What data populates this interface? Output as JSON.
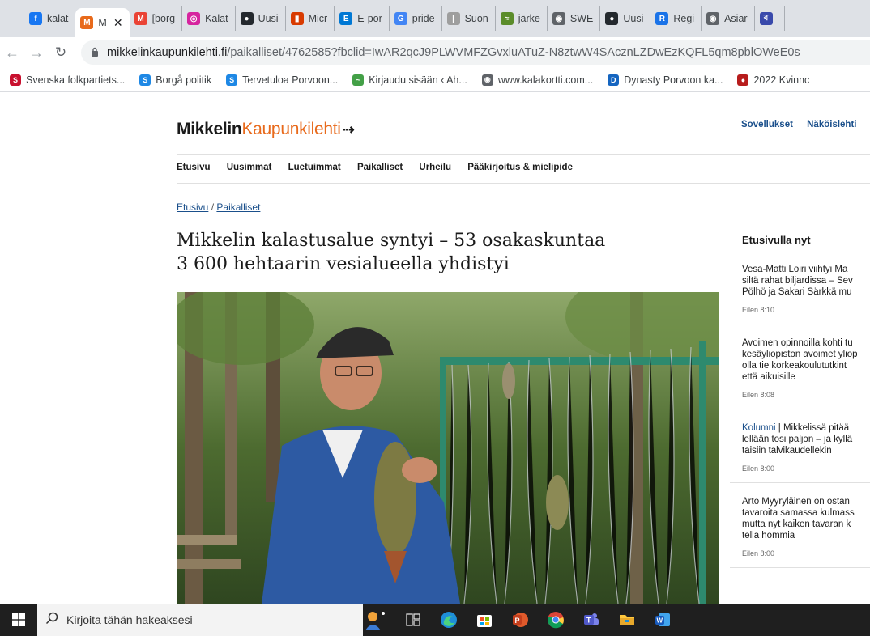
{
  "tabs": [
    {
      "label": "kalat",
      "icon": "facebook-icon",
      "color": "#1877f2",
      "glyph": "f"
    },
    {
      "label": "M",
      "icon": "site-icon",
      "color": "#e86a1c",
      "glyph": "M",
      "active": true
    },
    {
      "label": "[borg",
      "icon": "gmail-icon",
      "color": "#ea4335",
      "glyph": "M"
    },
    {
      "label": "Kalat",
      "icon": "instagram-icon",
      "color": "#d6249f",
      "glyph": "◎"
    },
    {
      "label": "Uusi",
      "icon": "github-icon",
      "color": "#24292e",
      "glyph": "●"
    },
    {
      "label": "Micr",
      "icon": "office-icon",
      "color": "#d83b01",
      "glyph": "▮"
    },
    {
      "label": "E-por",
      "icon": "portal-icon",
      "color": "#0078d4",
      "glyph": "E"
    },
    {
      "label": "pride",
      "icon": "google-icon",
      "color": "#4285f4",
      "glyph": "G"
    },
    {
      "label": "Suon",
      "icon": "generic-icon",
      "color": "#9e9e9e",
      "glyph": "|"
    },
    {
      "label": "järke",
      "icon": "fishing-icon",
      "color": "#5b8c2a",
      "glyph": "≈"
    },
    {
      "label": "SWE",
      "icon": "globe-icon",
      "color": "#5f6368",
      "glyph": "◉"
    },
    {
      "label": "Uusi",
      "icon": "github-icon",
      "color": "#24292e",
      "glyph": "●"
    },
    {
      "label": "Regi",
      "icon": "registry-icon",
      "color": "#1a73e8",
      "glyph": "R"
    },
    {
      "label": "Asiar",
      "icon": "globe-icon",
      "color": "#5f6368",
      "glyph": "◉"
    },
    {
      "label": "",
      "icon": "misc-icon",
      "color": "#3949ab",
      "glyph": "ব"
    }
  ],
  "url": {
    "domain": "mikkelinkaupunkilehti.fi",
    "path": "/paikalliset/4762585?fbclid=IwAR2qcJ9PLWVMFZGvxluATuZ-N8ztwW4SAcznLZDwEzKQFL5qm8pblOWeE0s"
  },
  "bookmarks": [
    {
      "label": "Svenska folkpartiets...",
      "color": "#c8102e",
      "glyph": "S"
    },
    {
      "label": "Borgå politik",
      "color": "#1e88e5",
      "glyph": "S"
    },
    {
      "label": "Tervetuloa Porvoon...",
      "color": "#1e88e5",
      "glyph": "S"
    },
    {
      "label": "Kirjaudu sisään ‹ Ah...",
      "color": "#43a047",
      "glyph": "~"
    },
    {
      "label": "www.kalakortti.com...",
      "color": "#5f6368",
      "glyph": "◉"
    },
    {
      "label": "Dynasty Porvoon ka...",
      "color": "#1565c0",
      "glyph": "D"
    },
    {
      "label": "2022 Kvinnc",
      "color": "#b71c1c",
      "glyph": "●"
    }
  ],
  "site": {
    "logo_part1": "Mikkelin",
    "logo_part2": "Kaupunkilehti",
    "top_links": [
      "Sovellukset",
      "Näköislehti"
    ],
    "nav": [
      "Etusivu",
      "Uusimmat",
      "Luetuimmat",
      "Paikalliset",
      "Urheilu",
      "Pääkirjoitus & mielipide"
    ],
    "breadcrumb": {
      "home": "Etusivu",
      "separator": "/",
      "section": "Paikalliset"
    }
  },
  "article": {
    "headline_line1": "Mikkelin kalastusalue syntyi – 53 osakaskuntaa",
    "headline_line2": "3 600 hehtaarin vesialueella yhdistyi"
  },
  "sidebar": {
    "title": "Etusivulla nyt",
    "items": [
      {
        "lines": [
          "Vesa-Matti Loiri viihtyi Ma",
          "siltä rahat biljardissa – Sev",
          "Pölhö ja Sakari Särkkä mu"
        ],
        "prefix": "",
        "time": "Eilen 8:10"
      },
      {
        "lines": [
          "Avoimen opinnoilla kohti tu",
          "kesäyliopiston avoimet yliop",
          "olla tie korkeakoulututkint",
          "että aikuisille"
        ],
        "prefix": "",
        "time": "Eilen 8:08"
      },
      {
        "lines": [
          "Mikkelissä pitää",
          "lellään tosi paljon – ja kyllä",
          "taisiin talvikaudellekin"
        ],
        "prefix": "Kolumni",
        "time": "Eilen 8:00"
      },
      {
        "lines": [
          "Arto Myyryläinen on ostan",
          "tavaroita samassa kulmass",
          "mutta nyt kaiken tavaran k",
          "tella hommia"
        ],
        "prefix": "",
        "time": "Eilen 8:00"
      }
    ]
  },
  "taskbar": {
    "search_placeholder": "Kirjoita tähän hakeaksesi",
    "apps": [
      "cortana-icon",
      "task-view-icon",
      "edge-icon",
      "store-icon",
      "powerpoint-icon",
      "chrome-icon",
      "teams-icon",
      "file-explorer-icon",
      "word-icon"
    ]
  }
}
